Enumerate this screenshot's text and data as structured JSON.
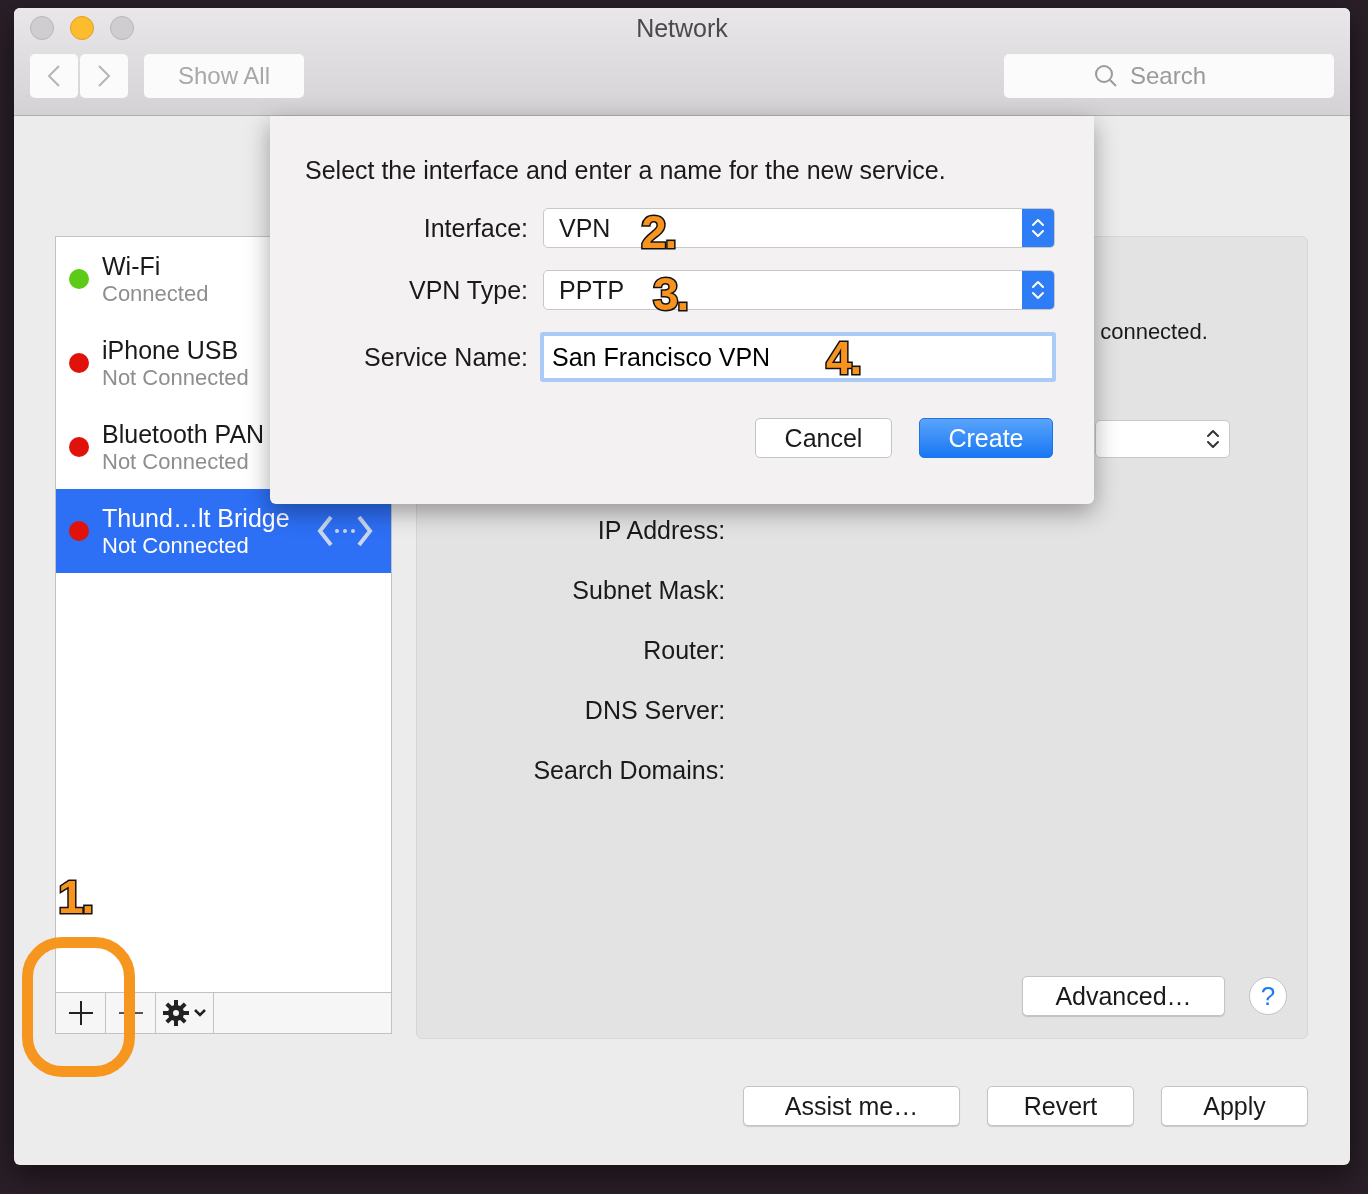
{
  "window": {
    "title": "Network"
  },
  "toolbar": {
    "show_all": "Show All",
    "search": {
      "placeholder": "Search"
    }
  },
  "services": [
    {
      "name": "Wi-Fi",
      "status": "Connected",
      "color": "#5ccb16",
      "selected": false,
      "kind": "plain"
    },
    {
      "name": "iPhone USB",
      "status": "Not Connected",
      "color": "#e0120b",
      "selected": false,
      "kind": "plain"
    },
    {
      "name": "Bluetooth PAN",
      "status": "Not Connected",
      "color": "#e0120b",
      "selected": false,
      "kind": "plain"
    },
    {
      "name": "Thund…lt Bridge",
      "status": "Not Connected",
      "color": "#e0120b",
      "selected": true,
      "kind": "bridge"
    }
  ],
  "detail": {
    "status_text": "connected.",
    "fields": [
      "IP Address:",
      "Subnet Mask:",
      "Router:",
      "DNS Server:",
      "Search Domains:"
    ],
    "advanced": "Advanced…",
    "help": "?"
  },
  "buttons": [
    "Assist me…",
    "Revert",
    "Apply"
  ],
  "dialog": {
    "message": "Select the interface and enter a name for the new service.",
    "fields": [
      {
        "kind": "popup",
        "label": "Interface:",
        "value": "VPN"
      },
      {
        "kind": "popup",
        "label": "VPN Type:",
        "value": "PPTP"
      },
      {
        "kind": "text",
        "label": "Service Name:",
        "value": "San Francisco VPN"
      }
    ],
    "buttons": [
      {
        "label": "Cancel",
        "default": false
      },
      {
        "label": "Create",
        "default": true
      }
    ]
  },
  "annotations": [
    "1.",
    "2.",
    "3.",
    "4."
  ]
}
